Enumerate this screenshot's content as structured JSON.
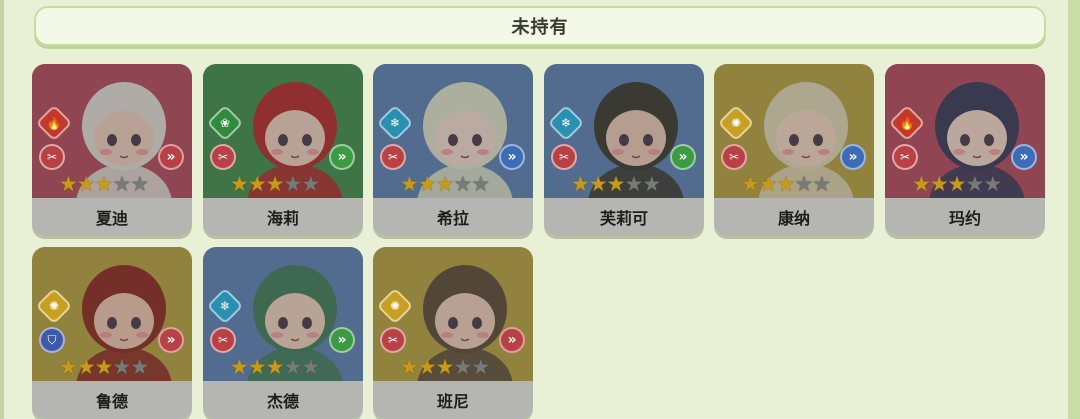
{
  "header": {
    "title": "未持有"
  },
  "colors": {
    "red": "#b04a4f",
    "green": "#3c8a46",
    "blue": "#5f7fae",
    "gold": "#b09a3a"
  },
  "cards": [
    {
      "name": "夏迪",
      "bg": "#b04a5a",
      "element": "fire-icon",
      "element_color": "#c0392b",
      "role": "sword-icon",
      "role_color": "#b94044",
      "arrow_color": "#b94044",
      "stars": 3,
      "max_stars": 5,
      "hair": "#dcd7d0",
      "skin": "#e8c8b8"
    },
    {
      "name": "海莉",
      "bg": "#3f8a4a",
      "element": "leaf-icon",
      "element_color": "#2f8c3f",
      "role": "sword-icon",
      "role_color": "#b94044",
      "arrow_color": "#3b9a42",
      "stars": 3,
      "max_stars": 5,
      "hair": "#b02a2a",
      "skin": "#e8c8b8"
    },
    {
      "name": "希拉",
      "bg": "#5a7eb0",
      "element": "snow-icon",
      "element_color": "#2a8fb0",
      "role": "sword-icon",
      "role_color": "#b94044",
      "arrow_color": "#3d6bb8",
      "stars": 3,
      "max_stars": 5,
      "hair": "#d8dcc4",
      "skin": "#ecd4c8"
    },
    {
      "name": "芙莉可",
      "bg": "#5a7eb0",
      "element": "snow-icon",
      "element_color": "#2a8fb0",
      "role": "sword-icon",
      "role_color": "#b94044",
      "arrow_color": "#3b9a42",
      "stars": 3,
      "max_stars": 5,
      "hair": "#3a3a30",
      "skin": "#e4c4b0"
    },
    {
      "name": "康纳",
      "bg": "#b29d3e",
      "element": "sun-icon",
      "element_color": "#c8a021",
      "role": "sword-icon",
      "role_color": "#b94044",
      "arrow_color": "#3d6bb8",
      "stars": 3,
      "max_stars": 5,
      "hair": "#d8d0b0",
      "skin": "#ecd0bc"
    },
    {
      "name": "玛约",
      "bg": "#b04a5a",
      "element": "fire-icon",
      "element_color": "#c0392b",
      "role": "sword-icon",
      "role_color": "#b94044",
      "arrow_color": "#3d6bb8",
      "stars": 3,
      "max_stars": 5,
      "hair": "#383858",
      "skin": "#ecd0c0"
    },
    {
      "name": "鲁德",
      "bg": "#b29d3e",
      "element": "sun-icon",
      "element_color": "#c8a021",
      "role": "shield-icon",
      "role_color": "#3d5aa8",
      "arrow_color": "#b94044",
      "stars": 3,
      "max_stars": 5,
      "hair": "#8a2a22",
      "skin": "#e8c0aa"
    },
    {
      "name": "杰德",
      "bg": "#5a7eb0",
      "element": "snow-icon",
      "element_color": "#2a8fb0",
      "role": "sword-icon",
      "role_color": "#b94044",
      "arrow_color": "#3b9a42",
      "stars": 3,
      "max_stars": 5,
      "hair": "#3f7a58",
      "skin": "#e8ccb8"
    },
    {
      "name": "班尼",
      "bg": "#b29d3e",
      "element": "sun-icon",
      "element_color": "#c8a021",
      "role": "sword-icon",
      "role_color": "#b94044",
      "arrow_color": "#b94044",
      "stars": 3,
      "max_stars": 5,
      "hair": "#5a4a38",
      "skin": "#e8c8b4"
    }
  ]
}
